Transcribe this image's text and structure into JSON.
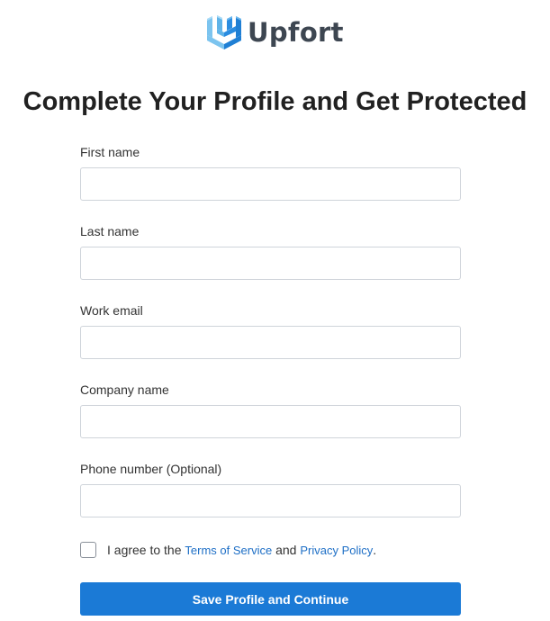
{
  "brand": {
    "name": "Upfort",
    "logo_icon": "upfort-shield-logo-icon",
    "colors": {
      "mark_light": "#7cc4ef",
      "mark_dark": "#1f7fd4",
      "wordmark": "#3d4651"
    }
  },
  "page_title": "Complete Your Profile and Get Protected",
  "form": {
    "fields": [
      {
        "label": "First name",
        "value": "",
        "placeholder": ""
      },
      {
        "label": "Last name",
        "value": "",
        "placeholder": ""
      },
      {
        "label": "Work email",
        "value": "",
        "placeholder": ""
      },
      {
        "label": "Company name",
        "value": "",
        "placeholder": ""
      },
      {
        "label": "Phone number (Optional)",
        "value": "",
        "placeholder": ""
      }
    ],
    "consent": {
      "checked": false,
      "text_before": "I agree to the ",
      "terms_link": "Terms of Service",
      "text_middle": " and ",
      "privacy_link": "Privacy Policy",
      "text_after": "."
    },
    "submit_label": "Save Profile and Continue"
  },
  "colors": {
    "primary_button": "#1b7ad6",
    "link": "#1e6fc6",
    "input_border": "#cfd4da"
  }
}
